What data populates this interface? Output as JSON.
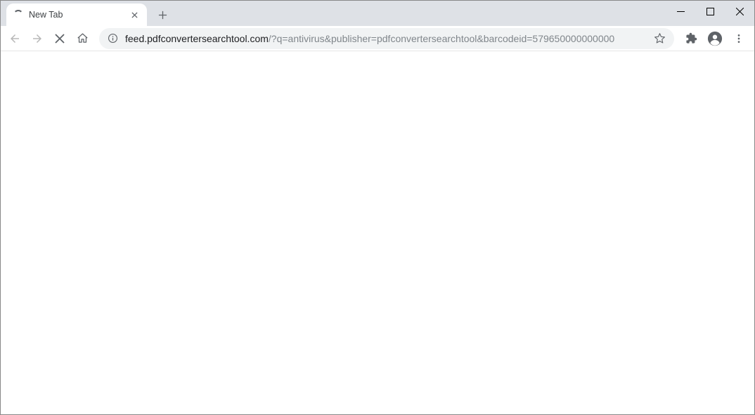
{
  "tab": {
    "title": "New Tab"
  },
  "url": {
    "domain": "feed.pdfconvertersearchtool.com",
    "path": "/?q=antivirus&publisher=pdfconvertersearchtool&barcodeid=579650000000000"
  }
}
